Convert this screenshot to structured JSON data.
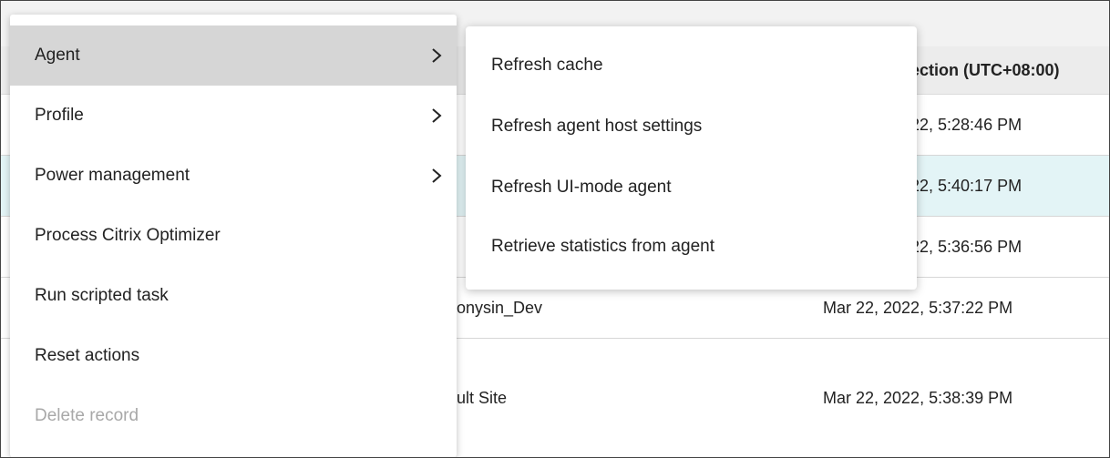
{
  "table": {
    "header_partial": "ection (UTC+08:00)",
    "rows": [
      {
        "name": "",
        "date": "22, 5:28:46 PM"
      },
      {
        "name": "",
        "date": "22, 5:40:17 PM"
      },
      {
        "name": "",
        "date": "22, 5:36:56 PM"
      },
      {
        "name": "onysin_Dev",
        "date": "Mar 22, 2022, 5:37:22 PM"
      },
      {
        "name": "ult Site",
        "date": "Mar 22, 2022, 5:38:39 PM"
      }
    ]
  },
  "context_menu": {
    "items": [
      {
        "label": "Agent",
        "has_submenu": true,
        "active": true,
        "enabled": true
      },
      {
        "label": "Profile",
        "has_submenu": true,
        "active": false,
        "enabled": true
      },
      {
        "label": "Power management",
        "has_submenu": true,
        "active": false,
        "enabled": true
      },
      {
        "label": "Process Citrix Optimizer",
        "has_submenu": false,
        "active": false,
        "enabled": true
      },
      {
        "label": "Run scripted task",
        "has_submenu": false,
        "active": false,
        "enabled": true
      },
      {
        "label": "Reset actions",
        "has_submenu": false,
        "active": false,
        "enabled": true
      },
      {
        "label": "Delete record",
        "has_submenu": false,
        "active": false,
        "enabled": false
      }
    ]
  },
  "submenu": {
    "items": [
      {
        "label": "Refresh cache"
      },
      {
        "label": "Refresh agent host settings"
      },
      {
        "label": "Refresh UI-mode agent"
      },
      {
        "label": "Retrieve statistics from agent"
      }
    ]
  },
  "icons": {
    "submenu_arrow": "chevron-right-icon"
  },
  "colors": {
    "active_item_bg": "#d6d6d6",
    "selected_row_bg": "#e3f4f6",
    "disabled_text": "#a8a8a8"
  }
}
